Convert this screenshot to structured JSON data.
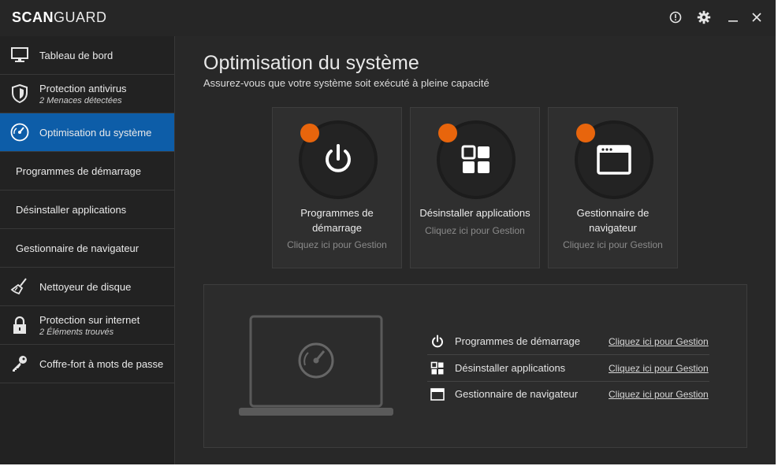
{
  "app": {
    "brand_bold": "SCAN",
    "brand_light": "GUARD"
  },
  "titlebar": {
    "icons": [
      "info-icon",
      "gear-icon",
      "minimize-icon",
      "close-icon"
    ]
  },
  "sidebar": {
    "items": [
      {
        "label": "Tableau de bord",
        "icon": "monitor-icon"
      },
      {
        "label": "Protection antivirus",
        "sub": "2 Menaces détectées",
        "icon": "shield-icon"
      },
      {
        "label": "Optimisation du système",
        "icon": "speedometer-icon",
        "active": true
      },
      {
        "label": "Programmes de démarrage"
      },
      {
        "label": "Désinstaller applications"
      },
      {
        "label": "Gestionnaire de navigateur"
      },
      {
        "label": "Nettoyeur de disque",
        "icon": "broom-icon"
      },
      {
        "label": "Protection sur internet",
        "sub": "2 Éléments trouvés",
        "icon": "lock-icon"
      },
      {
        "label": "Coffre-fort à mots de passe",
        "icon": "key-icon"
      }
    ]
  },
  "main": {
    "title": "Optimisation du système",
    "subtitle": "Assurez-vous que votre système soit exécuté à pleine capacité",
    "cards": [
      {
        "title_1": "Programmes de",
        "title_2": "démarrage",
        "link": "Cliquez ici pour Gestion",
        "icon": "power-icon"
      },
      {
        "title_1": "Désinstaller applications",
        "link": "Cliquez ici pour Gestion",
        "icon": "apps-grid-icon"
      },
      {
        "title_1": "Gestionnaire de",
        "title_2": "navigateur",
        "link": "Cliquez ici pour Gestion",
        "icon": "browser-window-icon"
      }
    ],
    "panel": {
      "rows": [
        {
          "label": "Programmes de démarrage",
          "link": "Cliquez ici pour Gestion",
          "icon": "power-icon"
        },
        {
          "label": "Désinstaller applications",
          "link": "Cliquez ici pour Gestion",
          "icon": "apps-grid-icon"
        },
        {
          "label": "Gestionnaire de navigateur",
          "link": "Cliquez ici pour Gestion",
          "icon": "browser-window-icon"
        }
      ]
    }
  },
  "colors": {
    "accent": "#0d5da8",
    "alert": "#e8650c",
    "background": "#282828"
  }
}
